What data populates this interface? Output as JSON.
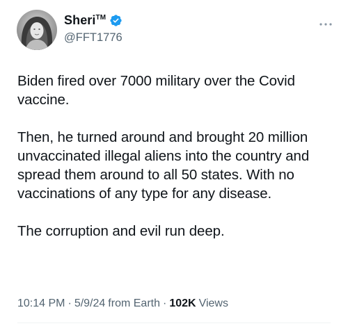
{
  "author": {
    "display_name": "Sheri",
    "trademark": "TM",
    "handle": "@FFT1776",
    "verified": true,
    "verified_color": "#1d9bf0",
    "avatar_icon": "profile-photo"
  },
  "tweet": {
    "paragraphs": [
      "Biden fired over 7000 military over the Covid vaccine.",
      "Then, he turned around and brought 20 million unvaccinated illegal aliens into the country and spread them around to all 50 states.  With no vaccinations of any type for any disease.",
      "The corruption and evil run deep."
    ]
  },
  "meta": {
    "time": "10:14 PM",
    "date": "5/9/24",
    "source": "from Earth",
    "separator": "·",
    "views_count": "102K",
    "views_label": "Views"
  },
  "icons": {
    "more": "more-horizontal-icon",
    "verified": "verified-badge-icon"
  }
}
